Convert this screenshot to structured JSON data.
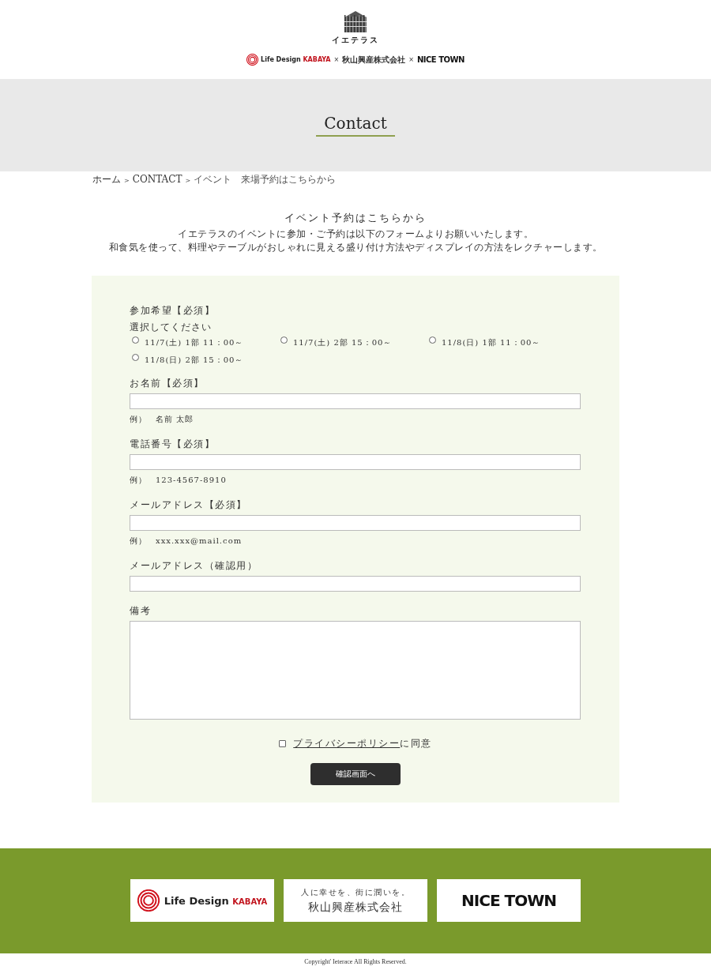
{
  "header": {
    "logo_text": "イエテラス",
    "partners": [
      {
        "kind": "kabaya",
        "name": "Life Design",
        "sub": "KABAYA"
      },
      {
        "kind": "sep",
        "name": "×"
      },
      {
        "kind": "plain",
        "name": "秋山興産株式会社"
      },
      {
        "kind": "sep",
        "name": "×"
      },
      {
        "kind": "nicetown",
        "name": "NICE TOWN"
      }
    ]
  },
  "banner": {
    "title": "Contact"
  },
  "breadcrumb": [
    {
      "kind": "link",
      "text": "ホーム"
    },
    {
      "kind": "sep",
      "text": ">"
    },
    {
      "kind": "link",
      "text": "CONTACT"
    },
    {
      "kind": "sep",
      "text": ">"
    },
    {
      "kind": "current",
      "text": "イベント　来場予約はこちらから"
    }
  ],
  "intro": {
    "title": "イベント予約はこちらから",
    "lines": [
      "イエテラスのイベントに参加・ご予約は以下のフォームよりお願いいたします。",
      "和食気を使って、料理やテーブルがおしゃれに見える盛り付け方法やディスプレイの方法をレクチャーします。"
    ]
  },
  "form": {
    "fields": [
      {
        "kind": "radio",
        "label": "参加希望【必須】",
        "hint": "選択してください",
        "options": [
          {
            "label": "11/7(土) 1部 11：00～",
            "selected": false
          },
          {
            "label": "11/7(土) 2部 15：00～",
            "selected": false
          },
          {
            "label": "11/8(日) 1部 11：00～",
            "selected": false
          },
          {
            "label": "11/8(日) 2部 15：00～",
            "selected": false
          }
        ]
      },
      {
        "kind": "text",
        "label": "お名前【必須】",
        "example": "例）　名前 太郎"
      },
      {
        "kind": "text",
        "label": "電話番号【必須】",
        "example": "例）　123-4567-8910"
      },
      {
        "kind": "text",
        "label": "メールアドレス【必須】",
        "example": "例）　xxx.xxx@mail.com"
      },
      {
        "kind": "text",
        "label": "メールアドレス（確認用）"
      },
      {
        "kind": "textarea",
        "label": "備考"
      }
    ],
    "consent": {
      "link": "プライバシーポリシー",
      "text": "に同意",
      "checked": false
    },
    "submit": "確認画面へ"
  },
  "footer": {
    "logos": [
      {
        "kind": "kabaya",
        "name": "Life Design",
        "sub": "KABAYA"
      },
      {
        "kind": "akiyama",
        "tagline": "人に幸せを、街に潤いを。",
        "name": "秋山興産株式会社"
      },
      {
        "kind": "nicetown",
        "name": "NICE TOWN"
      }
    ],
    "copyright": "Copyright' Ieterace All Rights Reserved."
  }
}
